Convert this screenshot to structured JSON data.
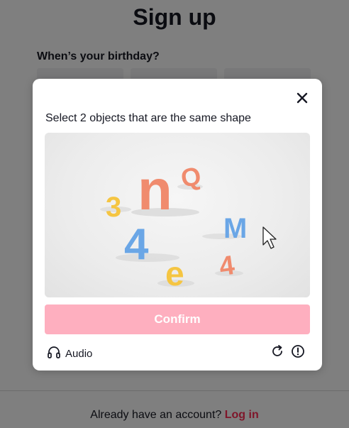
{
  "page": {
    "title": "Sign up",
    "birthday_label": "When’s your birthday?",
    "footer_prompt": "Already have an account?",
    "footer_link": "Log in"
  },
  "captcha": {
    "instruction": "Select 2 objects that are the same shape",
    "confirm_label": "Confirm",
    "audio_label": "Audio",
    "objects": [
      {
        "label": "n",
        "color": "#f08b6e"
      },
      {
        "label": "Q",
        "color": "#f08b6e"
      },
      {
        "label": "3",
        "color": "#f5c542"
      },
      {
        "label": "4",
        "color": "#6aa6e6"
      },
      {
        "label": "M",
        "color": "#6aa6e6"
      },
      {
        "label": "e",
        "color": "#f5c542"
      },
      {
        "label": "4",
        "color": "#f08b6e"
      }
    ],
    "icons": [
      "close-icon",
      "headphones-icon",
      "refresh-icon",
      "report-icon",
      "cursor-icon"
    ]
  },
  "colors": {
    "brand": "#fe2c55",
    "confirm_disabled": "#feafbf",
    "overlay": "rgba(0,0,0,0.5)"
  }
}
